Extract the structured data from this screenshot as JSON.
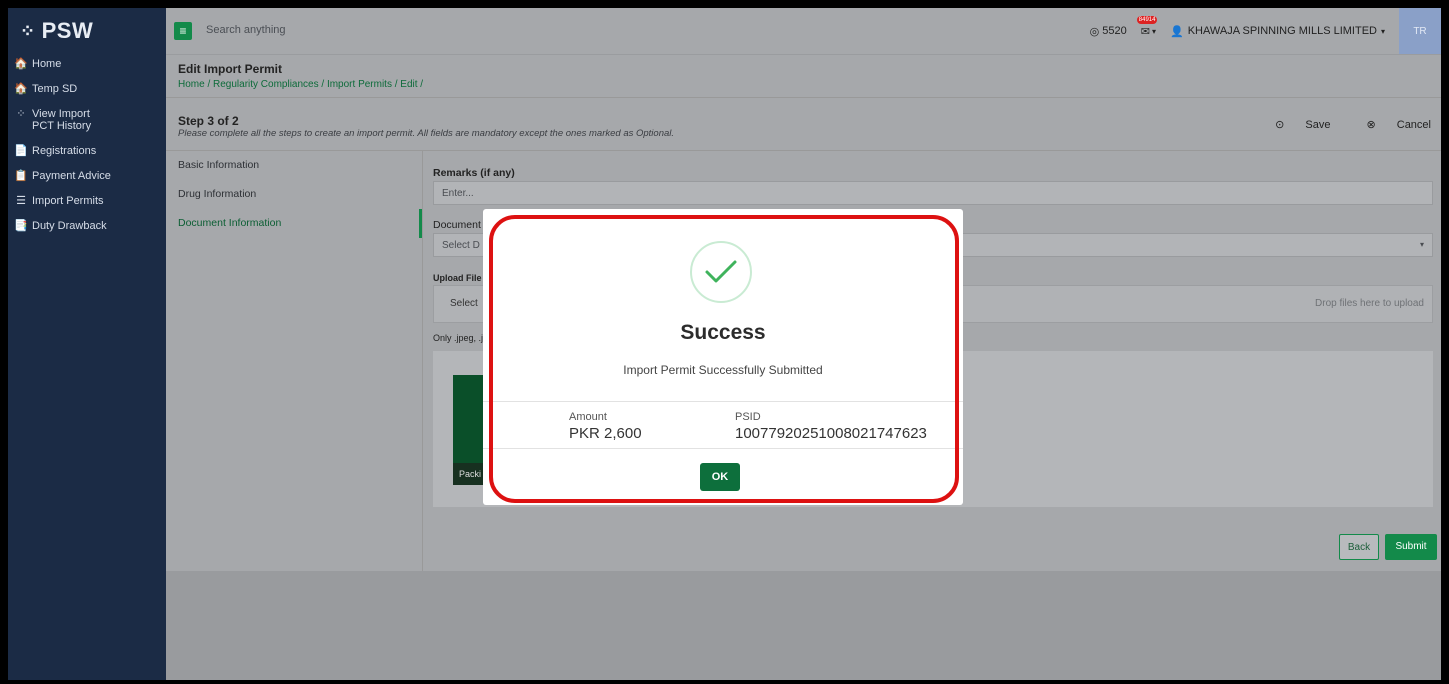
{
  "app": {
    "logo": "PSW",
    "logo_mark": "⁘"
  },
  "sidebar": {
    "items": [
      {
        "label": "Home",
        "icon": "🏠"
      },
      {
        "label": "Temp SD",
        "icon": "🏠"
      },
      {
        "label": "View Import PCT History",
        "icon": "⁘"
      },
      {
        "label": "Registrations",
        "icon": "📄"
      },
      {
        "label": "Payment Advice",
        "icon": "📋"
      },
      {
        "label": "Import Permits",
        "icon": "☰"
      },
      {
        "label": "Duty Drawback",
        "icon": "📑"
      }
    ]
  },
  "topbar": {
    "search_placeholder": "Search anything",
    "coins": "5520",
    "notification_count": "84914",
    "company": "KHAWAJA SPINNING MILLS LIMITED",
    "user_initials": "TR"
  },
  "page": {
    "title": "Edit Import Permit",
    "breadcrumb": "Home / Regularity Compliances / Import Permits / Edit /",
    "step_title": "Step 3 of 2",
    "step_desc": "Please complete all the steps to create an import permit. All fields are mandatory except the ones marked as Optional.",
    "save_label": "Save",
    "cancel_label": "Cancel"
  },
  "steps": [
    "Basic Information",
    "Drug Information",
    "Document Information"
  ],
  "form": {
    "remarks_label": "Remarks (if any)",
    "remarks_placeholder": "Enter...",
    "document_label": "Document",
    "document_select": "Select D",
    "upload_label": "Upload File",
    "upload_select": "Select",
    "drop_text": "Drop files here to upload",
    "allowed_text": "Only .jpeg, .j",
    "thumb_caption": "Packi",
    "back_label": "Back",
    "submit_label": "Submit"
  },
  "modal": {
    "title": "Success",
    "message": "Import Permit Successfully Submitted",
    "amount_label": "Amount",
    "amount_value": "PKR 2,600",
    "psid_label": "PSID",
    "psid_value": "1007792025100802174762​3",
    "ok_label": "OK"
  },
  "colors": {
    "primary": "#138a4a",
    "sidebar": "#1b2b45",
    "highlight_ring": "#dd1111"
  }
}
